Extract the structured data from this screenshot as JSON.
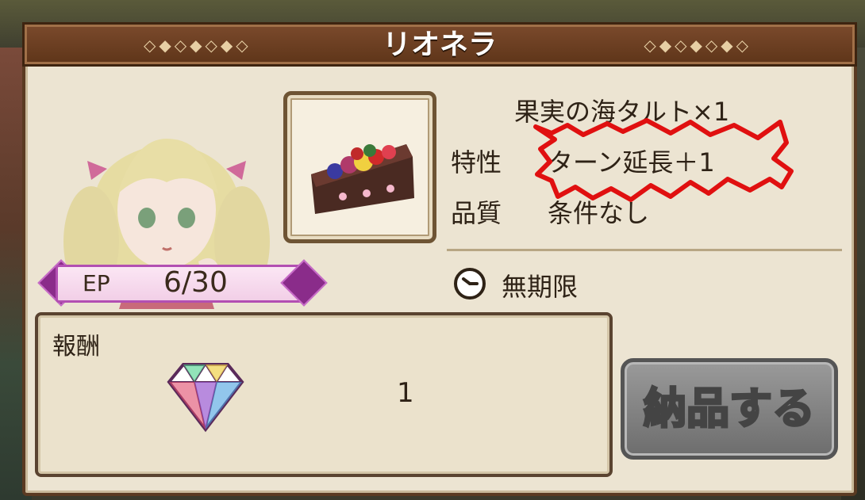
{
  "title": "リオネラ",
  "title_ornament": "◇◆◇◆◇◆◇",
  "ep": {
    "label": "EP",
    "value": "6/30"
  },
  "item": {
    "name": "果実の海タルト×1",
    "trait_label": "特性",
    "trait_value": "ターン延長＋1",
    "quality_label": "品質",
    "quality_value": "条件なし"
  },
  "deadline": "無期限",
  "reward": {
    "label": "報酬",
    "quantity": "1",
    "icon": "rainbow-gem-icon"
  },
  "deliver_button": "納品する",
  "colors": {
    "panel": "#ece4d2",
    "titlebar": "#6a3e22",
    "ep_frame": "#b24fb2",
    "scribble": "#e01010",
    "button": "#7f7f7f"
  }
}
